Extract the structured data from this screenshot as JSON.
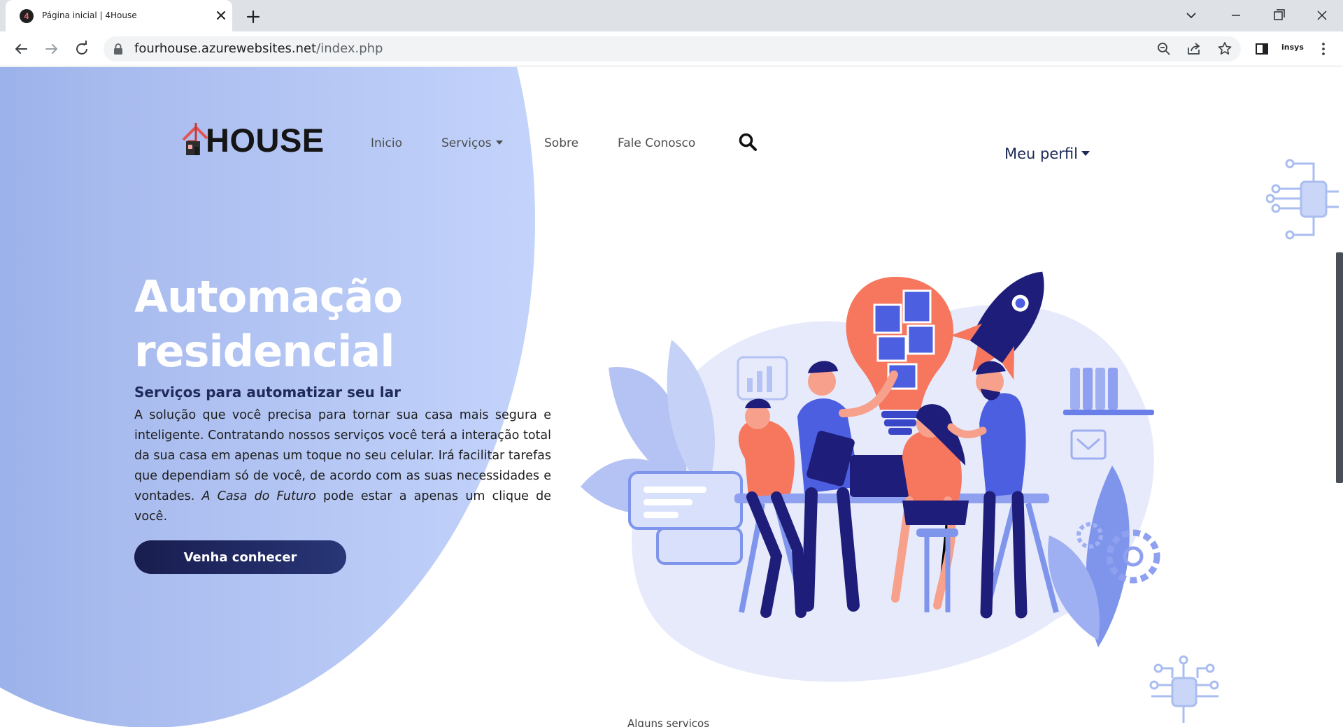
{
  "browser": {
    "tab": {
      "favicon_letter": "4",
      "title": "Página inicial | 4House",
      "close_glyph": "✕"
    },
    "new_tab_glyph": "+",
    "url_host": "fourhouse.azurewebsites.net",
    "url_path": "/index.php",
    "extension_label": "insys"
  },
  "site": {
    "logo_text": "HOUSE",
    "nav": {
      "home": "Inicio",
      "services": "Serviços",
      "about": "Sobre",
      "contact": "Fale Conosco"
    },
    "profile_label": "Meu perfil"
  },
  "hero": {
    "title_line1": "Automação",
    "title_line2": "residencial",
    "subtitle": "Serviços para automatizar seu lar",
    "body_main": "A solução que você precisa para tornar sua casa mais segura e inteligente. Contratando nossos serviços você terá a interação total da sua casa em apenas um toque no seu celular. Irá facilitar tarefas que dependiam só de você, de acordo com as suas necessidades e vontades.",
    "body_emphasis": "A Casa do Futuro",
    "body_end": "pode estar a apenas um clique de você.",
    "cta_label": "Venha conhecer"
  },
  "next_section_label": "Alguns serviços",
  "colors": {
    "brand_navy": "#1d2a57",
    "hero_gradient_start": "#7f9fe0",
    "hero_gradient_end": "#c3d3fb",
    "accent_coral": "#f6765e",
    "illustration_blue": "#4b5fe0"
  }
}
